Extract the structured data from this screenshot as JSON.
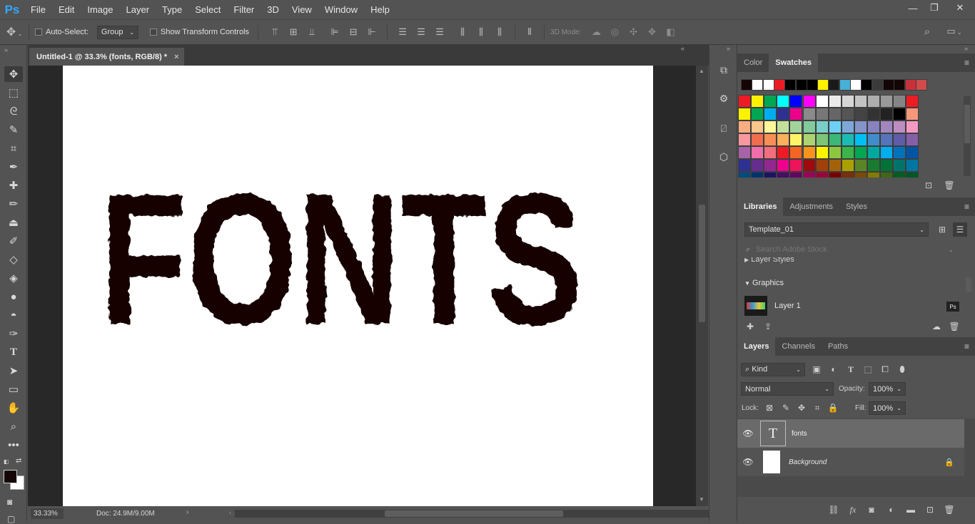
{
  "app": {
    "logo": "Ps"
  },
  "menu": [
    "File",
    "Edit",
    "Image",
    "Layer",
    "Type",
    "Select",
    "Filter",
    "3D",
    "View",
    "Window",
    "Help"
  ],
  "window_controls": {
    "minimize": "—",
    "restore": "❐",
    "close": "✕"
  },
  "options_bar": {
    "auto_select_label": "Auto-Select:",
    "auto_select_value": "Group",
    "show_transform_label": "Show Transform Controls",
    "mode_3d_label": "3D Mode:"
  },
  "document": {
    "tab_title": "Untitled-1 @ 33.3% (fonts, RGB/8) *",
    "tab_close": "×",
    "canvas_text": "FONTS",
    "text_color": "#140606"
  },
  "status": {
    "zoom": "33.33%",
    "doc_size": "Doc: 24.9M/9.00M"
  },
  "swatches_panel": {
    "tabs": [
      "Color",
      "Swatches"
    ],
    "active_tab": "Swatches",
    "recent": [
      "#140606",
      "#ffffff",
      "#ffffff",
      "#ec1c24",
      "#000000",
      "#000000",
      "#000000",
      "#fff200",
      "#1a1a1a",
      "#46b0d7",
      "#ffffff",
      "#000000",
      "#3a3a3a",
      "#140606",
      "#140606",
      "#c7323a",
      "#d14b4b"
    ],
    "grid": [
      [
        "#ed1c24",
        "#fff200",
        "#00a651",
        "#00ffff",
        "#0000ff",
        "#ff00ff",
        "#ffffff",
        "#ebebeb",
        "#d6d6d6",
        "#c2c2c2",
        "#adadad",
        "#999999",
        "#858585",
        "#ed1c24"
      ],
      [
        "#fff200",
        "#00a651",
        "#00aeef",
        "#2e3192",
        "#ec008c",
        "#8a8a8a",
        "#777777",
        "#666666",
        "#555555",
        "#444444",
        "#333333",
        "#222222",
        "#000000",
        "#f7977a"
      ],
      [
        "#f9ad81",
        "#fdc68a",
        "#fff79a",
        "#c4df9b",
        "#a2d39c",
        "#82ca9d",
        "#7bcdc8",
        "#6ecff6",
        "#7ea7d8",
        "#8493ca",
        "#8882be",
        "#a187be",
        "#bc8dbf",
        "#f49ac2"
      ],
      [
        "#f6989d",
        "#f26c4f",
        "#f68e55",
        "#fbaf5d",
        "#fff467",
        "#acd372",
        "#7cc576",
        "#3bb878",
        "#1abbb4",
        "#00bff3",
        "#438ccb",
        "#5574b9",
        "#605ca8",
        "#855fa8"
      ],
      [
        "#a763a8",
        "#f06ea9",
        "#f26d7d",
        "#ed1c24",
        "#f26522",
        "#f7941d",
        "#fff200",
        "#8dc63f",
        "#39b54a",
        "#00a651",
        "#00a99d",
        "#00aeef",
        "#0072bc",
        "#0054a6"
      ],
      [
        "#2e3192",
        "#662d91",
        "#92278f",
        "#ec008c",
        "#ed145b",
        "#9e0b0f",
        "#a0410d",
        "#a36209",
        "#aba000",
        "#598527",
        "#1a7b30",
        "#007236",
        "#00746b",
        "#0076a3"
      ],
      [
        "#004b80",
        "#003471",
        "#1b1464",
        "#440e62",
        "#630460",
        "#9e005d",
        "#9e0039",
        "#790000",
        "#7b2e00",
        "#7d4900",
        "#827b00",
        "#406618",
        "#005e20",
        "#005826"
      ]
    ]
  },
  "libraries_panel": {
    "tabs": [
      "Libraries",
      "Adjustments",
      "Styles"
    ],
    "active_tab": "Libraries",
    "library_name": "Template_01",
    "search_placeholder": "Search Adobe Stock",
    "section_layer_styles": "Layer Styles",
    "section_graphics": "Graphics",
    "graphic_item": "Layer 1",
    "graphic_badge": "Ps"
  },
  "layers_panel": {
    "tabs": [
      "Layers",
      "Channels",
      "Paths"
    ],
    "active_tab": "Layers",
    "filter_kind": "Kind",
    "blend_mode": "Normal",
    "opacity_label": "Opacity:",
    "opacity_value": "100%",
    "lock_label": "Lock:",
    "fill_label": "Fill:",
    "fill_value": "100%",
    "layers": [
      {
        "name": "fonts",
        "type_glyph": "T"
      },
      {
        "name": "Background"
      }
    ]
  }
}
